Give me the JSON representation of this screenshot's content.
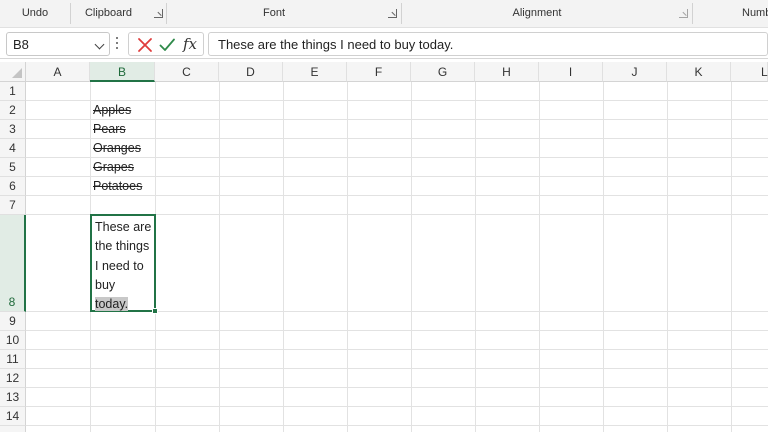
{
  "ribbon": {
    "groups": [
      {
        "label": "Undo"
      },
      {
        "label": "Clipboard"
      },
      {
        "label": "Font"
      },
      {
        "label": "Alignment"
      },
      {
        "label": "Numb"
      }
    ]
  },
  "formula_bar": {
    "name_box": "B8",
    "formula": "These are the things I need to buy today."
  },
  "grid": {
    "columns": [
      "A",
      "B",
      "C",
      "D",
      "E",
      "F",
      "G",
      "H",
      "I",
      "J",
      "K",
      "L"
    ],
    "rows": [
      "1",
      "2",
      "3",
      "4",
      "5",
      "6",
      "7",
      "8",
      "9",
      "10",
      "11",
      "12",
      "13",
      "14"
    ],
    "selected_column": "B",
    "selected_row": "8"
  },
  "cells": {
    "B2": "Apples",
    "B3": "Pears",
    "B4": "Oranges",
    "B5": "Grapes",
    "B6": "Potatoes",
    "B8_lines": [
      "These are",
      "the things",
      "I need to",
      "buy",
      "today."
    ]
  },
  "colors": {
    "accent": "#217346",
    "header_bg": "#f5f5f5",
    "selection_highlight": "#c8c8c8"
  }
}
